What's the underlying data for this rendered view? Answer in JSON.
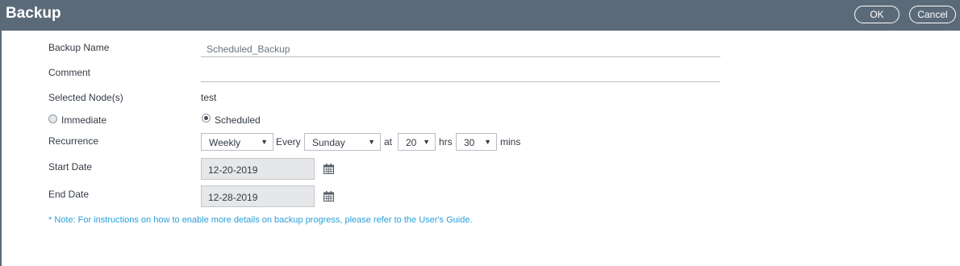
{
  "header": {
    "title": "Backup",
    "ok_label": "OK",
    "cancel_label": "Cancel"
  },
  "form": {
    "backup_name_label": "Backup Name",
    "backup_name_value": "Scheduled_Backup",
    "comment_label": "Comment",
    "comment_value": "",
    "selected_nodes_label": "Selected Node(s)",
    "selected_nodes_value": "test",
    "immediate_label": "Immediate",
    "scheduled_label": "Scheduled",
    "mode_selected": "Scheduled",
    "recurrence_label": "Recurrence",
    "recurrence": {
      "frequency": "Weekly",
      "every_text": "Every",
      "day": "Sunday",
      "at_text": "at",
      "hours": "20",
      "hrs_text": "hrs",
      "minutes": "30",
      "mins_text": "mins"
    },
    "start_date_label": "Start Date",
    "start_date_value": "12-20-2019",
    "end_date_label": "End Date",
    "end_date_value": "12-28-2019"
  },
  "note": "* Note: For instructions on how to enable more details on backup progress, please refer to the User's Guide.",
  "colors": {
    "header_bg": "#5b6a79",
    "note": "#2a9fd8",
    "date_bg": "#e6e7e9"
  }
}
